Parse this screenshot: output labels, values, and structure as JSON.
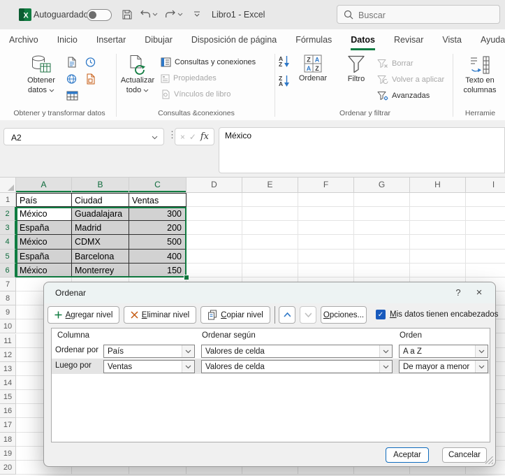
{
  "colors": {
    "excel_green": "#107c41",
    "accent_blue": "#185abd",
    "selection_fill": "#d2d2d2",
    "tab_underline": "#117c43",
    "disabled_text": "#a8a8a8"
  },
  "icons": {
    "excel_logo_letter": "X",
    "cancel_x": "×",
    "check": "✓",
    "fx": "fx",
    "more_dots": "⋮",
    "help": "?",
    "close": "×",
    "sort_a": "A",
    "sort_z": "Z",
    "down_arrow": "↓"
  },
  "titlebar": {
    "autosave_label": "Autoguardado",
    "autosave_state": "off",
    "doc_title": "Libro1 - Excel",
    "search_placeholder": "Buscar"
  },
  "tabs": [
    {
      "label": "Archivo"
    },
    {
      "label": "Inicio"
    },
    {
      "label": "Insertar"
    },
    {
      "label": "Dibujar"
    },
    {
      "label": "Disposición de página"
    },
    {
      "label": "Fórmulas"
    },
    {
      "label": "Datos",
      "active": true
    },
    {
      "label": "Revisar"
    },
    {
      "label": "Vista"
    },
    {
      "label": "Ayuda"
    }
  ],
  "ribbon": {
    "obtener": {
      "line1": "Obtener",
      "line2": "datos"
    },
    "actualizar": {
      "line1": "Actualizar",
      "line2": "todo"
    },
    "items": {
      "consultas": "Consultas y conexiones",
      "propiedades": "Propiedades",
      "vinculos": "Vínculos de libro",
      "borrar": "Borrar",
      "volver": "Volver a aplicar",
      "avanzadas": "Avanzadas"
    },
    "ordenar": "Ordenar",
    "filtro": "Filtro",
    "texto": {
      "line1": "Texto en",
      "line2": "columnas"
    },
    "groups": {
      "g1": "Obtener y transformar datos",
      "g2": "Consultas &conexiones",
      "g3": "Ordenar y filtrar",
      "g4": "Herramie"
    }
  },
  "formula_bar": {
    "name_box": "A2",
    "value": "México"
  },
  "sheet": {
    "column_headers": [
      "A",
      "B",
      "C",
      "D",
      "E",
      "F",
      "G",
      "H",
      "I"
    ],
    "row_count": 20,
    "selected_range": "A2:C6",
    "active_cell": "A2",
    "table": {
      "headers": [
        "País",
        "Ciudad",
        "Ventas"
      ],
      "rows": [
        [
          "México",
          "Guadalajara",
          "300"
        ],
        [
          "España",
          "Madrid",
          "200"
        ],
        [
          "México",
          "CDMX",
          "500"
        ],
        [
          "España",
          "Barcelona",
          "400"
        ],
        [
          "México",
          "Monterrey",
          "150"
        ]
      ]
    }
  },
  "dialog": {
    "title": "Ordenar",
    "add_level": "Agregar nivel",
    "delete_level": "Eliminar nivel",
    "copy_level": "Copiar nivel",
    "options": "Opciones...",
    "header_checkbox": "Mis datos tienen encabezados",
    "header_checkbox_checked": true,
    "table": {
      "headers": [
        "Columna",
        "Ordenar según",
        "Orden"
      ]
    },
    "levels": [
      {
        "row_label": "Ordenar por",
        "column": "País",
        "sort_on": "Valores de celda",
        "order": "A a Z"
      },
      {
        "row_label": "Luego por",
        "column": "Ventas",
        "sort_on": "Valores de celda",
        "order": "De mayor a menor"
      }
    ],
    "ok": "Aceptar",
    "cancel": "Cancelar"
  }
}
